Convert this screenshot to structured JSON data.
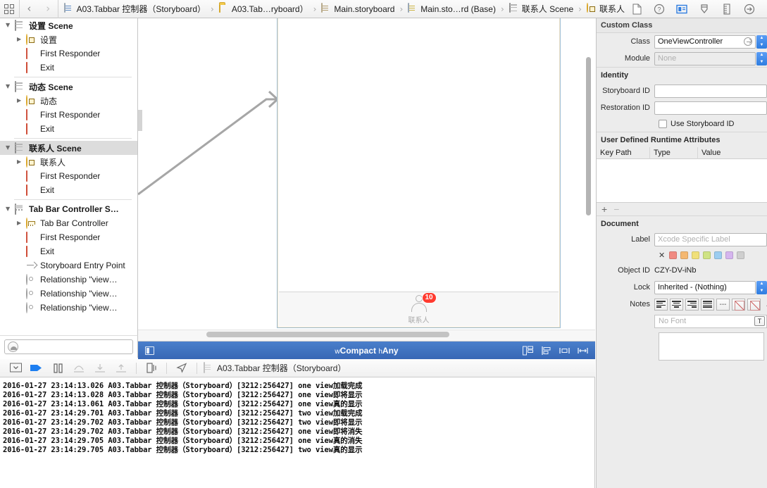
{
  "jumpbar": {
    "related_items_icon": "related-items-icon",
    "back_label": "‹",
    "forward_label": "›",
    "crumbs": [
      {
        "label": "A03.Tabbar 控制器（Storyboard）",
        "icon": "project-file-icon"
      },
      {
        "label": "A03.Tab…ryboard）",
        "icon": "folder-icon"
      },
      {
        "label": "Main.storyboard",
        "icon": "storyboard-file-icon"
      },
      {
        "label": "Main.sto…rd (Base)",
        "icon": "storyboard-base-file-icon"
      },
      {
        "label": "联系人 Scene",
        "icon": "scene-icon"
      },
      {
        "label": "联系人",
        "icon": "view-controller-icon"
      }
    ],
    "separator": "›",
    "right_buttons": [
      {
        "name": "file-inspector-icon"
      },
      {
        "name": "quick-help-inspector-icon"
      },
      {
        "name": "identity-inspector-icon"
      },
      {
        "name": "attributes-inspector-icon"
      },
      {
        "name": "size-inspector-icon"
      },
      {
        "name": "connections-inspector-icon"
      }
    ]
  },
  "outline": {
    "rows": [
      {
        "label": "设置 Scene",
        "icon": "scene-icon",
        "indent": 0,
        "twisty": "▼",
        "bold": true,
        "selected": false
      },
      {
        "label": "设置",
        "icon": "view-controller-icon",
        "indent": 1,
        "twisty": "▶",
        "bold": false,
        "selected": false
      },
      {
        "label": "First Responder",
        "icon": "first-responder-icon",
        "indent": 1,
        "twisty": "",
        "bold": false,
        "selected": false
      },
      {
        "label": "Exit",
        "icon": "exit-icon",
        "indent": 1,
        "twisty": "",
        "bold": false,
        "selected": false
      },
      {
        "divider": true
      },
      {
        "label": "动态 Scene",
        "icon": "scene-icon",
        "indent": 0,
        "twisty": "▼",
        "bold": true,
        "selected": false
      },
      {
        "label": "动态",
        "icon": "view-controller-icon",
        "indent": 1,
        "twisty": "▶",
        "bold": false,
        "selected": false
      },
      {
        "label": "First Responder",
        "icon": "first-responder-icon",
        "indent": 1,
        "twisty": "",
        "bold": false,
        "selected": false
      },
      {
        "label": "Exit",
        "icon": "exit-icon",
        "indent": 1,
        "twisty": "",
        "bold": false,
        "selected": false
      },
      {
        "divider": true
      },
      {
        "label": "联系人 Scene",
        "icon": "scene-icon",
        "indent": 0,
        "twisty": "▼",
        "bold": true,
        "selected": true
      },
      {
        "label": "联系人",
        "icon": "view-controller-icon",
        "indent": 1,
        "twisty": "▶",
        "bold": false,
        "selected": false
      },
      {
        "label": "First Responder",
        "icon": "first-responder-icon",
        "indent": 1,
        "twisty": "",
        "bold": false,
        "selected": false
      },
      {
        "label": "Exit",
        "icon": "exit-icon",
        "indent": 1,
        "twisty": "",
        "bold": false,
        "selected": false
      },
      {
        "divider": true
      },
      {
        "label": "Tab Bar Controller S…",
        "icon": "tabbar-scene-icon",
        "indent": 0,
        "twisty": "▼",
        "bold": true,
        "selected": false
      },
      {
        "label": "Tab Bar Controller",
        "icon": "tabbar-controller-icon",
        "indent": 1,
        "twisty": "▶",
        "bold": false,
        "selected": false
      },
      {
        "label": "First Responder",
        "icon": "first-responder-icon",
        "indent": 1,
        "twisty": "",
        "bold": false,
        "selected": false
      },
      {
        "label": "Exit",
        "icon": "exit-icon",
        "indent": 1,
        "twisty": "",
        "bold": false,
        "selected": false
      },
      {
        "label": "Storyboard Entry Point",
        "icon": "entry-point-icon",
        "indent": 1,
        "twisty": "",
        "bold": false,
        "selected": false
      },
      {
        "label": "Relationship \"view…",
        "icon": "relationship-icon",
        "indent": 1,
        "twisty": "",
        "bold": false,
        "selected": false
      },
      {
        "label": "Relationship \"view…",
        "icon": "relationship-icon",
        "indent": 1,
        "twisty": "",
        "bold": false,
        "selected": false
      },
      {
        "label": "Relationship \"view…",
        "icon": "relationship-icon",
        "indent": 1,
        "twisty": "",
        "bold": false,
        "selected": false
      }
    ],
    "filter_placeholder": ""
  },
  "canvas": {
    "tab_item": {
      "badge": "10",
      "label": "联系人",
      "badge_color": "#ff3b30",
      "icon": "contacts-person-icon"
    },
    "selection_border_color": "#9fc0d8"
  },
  "sizebar": {
    "device_icon": "device-preview-icon",
    "title_prefix": "w",
    "title_w": "Compact",
    "title_h_prefix": "h",
    "title_h": "Any",
    "full_title": "wCompact hAny",
    "right_buttons": [
      {
        "name": "show-assistant-grid-icon"
      },
      {
        "name": "align-icon"
      },
      {
        "name": "pin-icon"
      },
      {
        "name": "resolve-auto-layout-icon"
      }
    ]
  },
  "debugbar": {
    "buttons": [
      {
        "name": "hide-console-icon"
      },
      {
        "name": "continue-icon"
      },
      {
        "name": "pause-icon"
      },
      {
        "name": "step-over-icon"
      },
      {
        "name": "step-into-icon"
      },
      {
        "name": "step-out-icon"
      },
      {
        "name": "simulate-location-icon"
      },
      {
        "name": "view-debugging-icon"
      }
    ],
    "crumb_label": "A03.Tabbar 控制器（Storyboard）"
  },
  "console": {
    "lines": [
      "2016-01-27 23:14:13.026 A03.Tabbar 控制器（Storyboard）[3212:256427] one view加载完成",
      "2016-01-27 23:14:13.028 A03.Tabbar 控制器（Storyboard）[3212:256427] one view即将显示",
      "2016-01-27 23:14:13.061 A03.Tabbar 控制器（Storyboard）[3212:256427] one view真的显示",
      "2016-01-27 23:14:29.701 A03.Tabbar 控制器（Storyboard）[3212:256427] two view加载完成",
      "2016-01-27 23:14:29.702 A03.Tabbar 控制器（Storyboard）[3212:256427] two view即将显示",
      "2016-01-27 23:14:29.702 A03.Tabbar 控制器（Storyboard）[3212:256427] one view即将消失",
      "2016-01-27 23:14:29.705 A03.Tabbar 控制器（Storyboard）[3212:256427] one view真的消失",
      "2016-01-27 23:14:29.705 A03.Tabbar 控制器（Storyboard）[3212:256427] two view真的显示"
    ]
  },
  "inspector": {
    "custom_class": {
      "title": "Custom Class",
      "class_label": "Class",
      "class_value": "OneViewController",
      "module_label": "Module",
      "module_placeholder": "None"
    },
    "identity": {
      "title": "Identity",
      "storyboard_id_label": "Storyboard ID",
      "storyboard_id_value": "",
      "restoration_id_label": "Restoration ID",
      "restoration_id_value": "",
      "use_storyboard_id_label": "Use Storyboard ID",
      "use_storyboard_id_checked": false
    },
    "udra": {
      "title": "User Defined Runtime Attributes",
      "columns": [
        "Key Path",
        "Type",
        "Value"
      ],
      "rows": [],
      "add_label": "+",
      "remove_label": "−"
    },
    "document": {
      "title": "Document",
      "label_label": "Label",
      "label_placeholder": "Xcode Specific Label",
      "swatch_clear": "✕",
      "swatches": [
        "#f08a82",
        "#f4b871",
        "#f0e07a",
        "#cfe384",
        "#9ccdf0",
        "#d5b5ee",
        "#cfcfcf"
      ],
      "object_id_label": "Object ID",
      "object_id_value": "CZY-DV-iNb",
      "lock_label": "Lock",
      "lock_value": "Inherited - (Nothing)",
      "notes_label": "Notes",
      "font_placeholder": "No Font",
      "font_button": "T",
      "notes_more": "…"
    }
  }
}
